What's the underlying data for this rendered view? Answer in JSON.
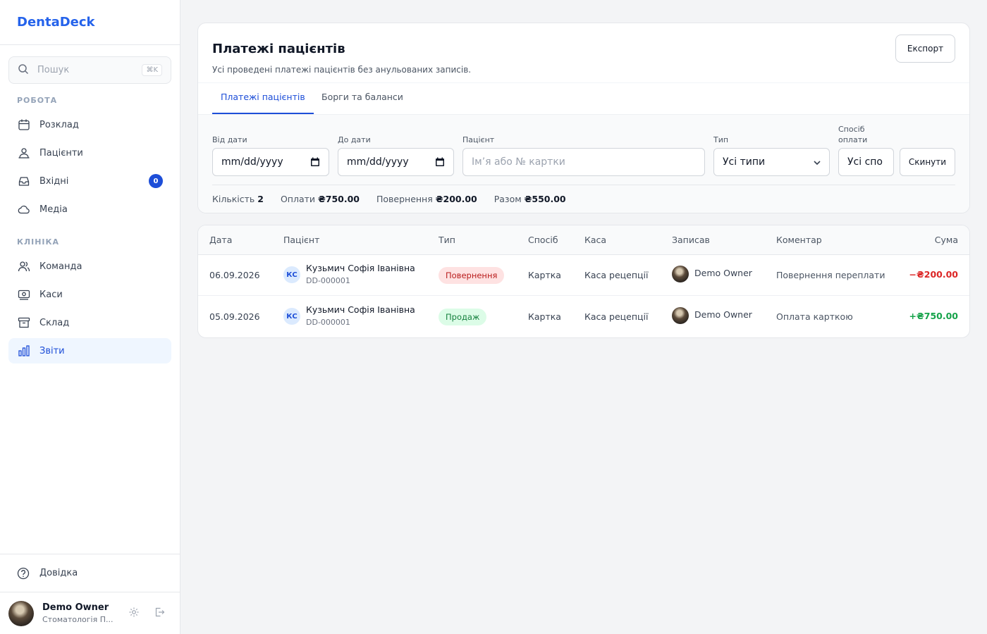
{
  "sidebar": {
    "brand": "DentaDeck",
    "search": {
      "placeholder": "Пошук",
      "shortcut": "⌘K"
    },
    "sections": [
      {
        "label": "РОБОТА",
        "items": [
          {
            "label": "Розклад",
            "icon": "calendar-icon"
          },
          {
            "label": "Пацієнти",
            "icon": "users-icon"
          },
          {
            "label": "Вхідні",
            "icon": "inbox-icon",
            "badge": "0"
          },
          {
            "label": "Медіа",
            "icon": "cloud-icon"
          }
        ]
      },
      {
        "label": "КЛІНІКА",
        "items": [
          {
            "label": "Команда",
            "icon": "team-icon"
          },
          {
            "label": "Каси",
            "icon": "cash-icon"
          },
          {
            "label": "Склад",
            "icon": "archive-icon"
          },
          {
            "label": "Звіти",
            "icon": "bar-chart-icon",
            "active": true
          }
        ]
      }
    ],
    "help": "Довідка",
    "user": {
      "name": "Demo Owner",
      "org": "Стоматологія П..."
    }
  },
  "header": {
    "title": "Платежі пацієнтів",
    "subtitle": "Усі проведені платежі пацієнтів без анульованих записів.",
    "export_label": "Експорт"
  },
  "tabs": [
    {
      "label": "Платежі пацієнтів",
      "active": true
    },
    {
      "label": "Борги та баланси",
      "active": false
    }
  ],
  "filters": {
    "from_label": "Від дати",
    "from_value": "mm/dd/yyyy",
    "to_label": "До дати",
    "to_value": "mm/dd/yyyy",
    "patient_label": "Пацієнт",
    "patient_placeholder": "Ім’я або № картки",
    "type_label": "Тип",
    "type_value": "Усі типи",
    "method_label_1": "Спосіб",
    "method_label_2": "оплати",
    "method_value": "Усі спо",
    "reset_label": "Скинути"
  },
  "summary": {
    "count_label": "Кількість",
    "count_value": "2",
    "payments_label": "Оплати",
    "payments_value": "₴750.00",
    "refunds_label": "Повернення",
    "refunds_value": "₴200.00",
    "total_label": "Разом",
    "total_value": "₴550.00"
  },
  "table": {
    "columns": [
      "Дата",
      "Пацієнт",
      "Тип",
      "Спосіб",
      "Каса",
      "Записав",
      "Коментар",
      "Сума"
    ],
    "rows": [
      {
        "date": "06.09.2026",
        "initials": "КС",
        "patient": "Кузьмич Софія Іванівна",
        "card": "DD-000001",
        "type": "Повернення",
        "method": "Картка",
        "cashbox": "Каса рецепції",
        "recorded_by": "Demo Owner",
        "comment": "Повернення переплати",
        "amount": "−₴200.00"
      },
      {
        "date": "05.09.2026",
        "initials": "КС",
        "patient": "Кузьмич Софія Іванівна",
        "card": "DD-000001",
        "type": "Продаж",
        "method": "Картка",
        "cashbox": "Каса рецепції",
        "recorded_by": "Demo Owner",
        "comment": "Оплата карткою",
        "amount": "+₴750.00"
      }
    ]
  },
  "colors": {
    "accent": "#1d4ed8",
    "brand": "#2563eb",
    "negative": "#dc2626",
    "positive": "#16a34a"
  }
}
